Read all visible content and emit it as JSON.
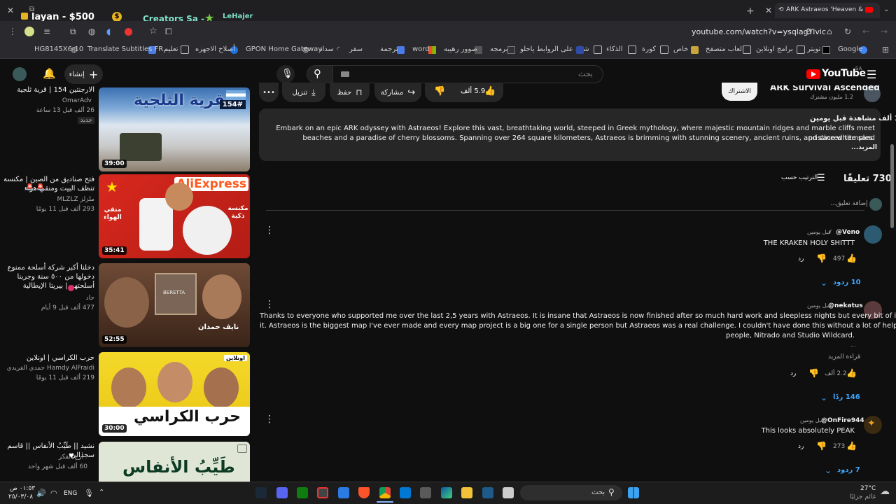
{
  "browser": {
    "tab_left_title": "layan - $500",
    "tab_left_sub": "Creators Sa -",
    "tab_left_user": "LeHajer",
    "active_tab_title": "ARK Astraeos 'Heaven & Aby",
    "url": "youtube.com/watch?v=ysqlagYlvic",
    "bookmarks": [
      "Google",
      "تويتر",
      "برامج اونلاين",
      "العاب متصفح",
      "خاص",
      "كورة",
      "الذكاء",
      "شيك على الروابط ياحلو",
      "برمجه",
      "صوور رهيبه",
      "word",
      "ترجمة",
      "سفر",
      "سداد",
      "GPON Home Gateway",
      "أصلاح الاجهزه",
      "تعليم",
      "Translate Subtitles FR...",
      "HG8145X6-10"
    ]
  },
  "youtube": {
    "logo": "YouTube",
    "region": "SA",
    "search_placeholder": "بحث",
    "create_label": "إنشاء"
  },
  "sidebar": {
    "videos": [
      {
        "title": "الارجنتين 154 | قرية ثلجية",
        "channel": "OmarAdv",
        "meta": "26 ألف  قبل 13 ساعة",
        "badge": "جديد",
        "duration": "39:00",
        "thumb_text": "القرية الثلجية",
        "thumb_num": "154#"
      },
      {
        "title": "فتح صناديق من الصين | مكنسة تنظف البيت ومنقي هواء",
        "channel": "ملزلز MLZLZ",
        "meta": "293 ألف  قبل 11 يومًا",
        "duration": "35:41",
        "thumb_text": "AliExpress",
        "thumb_tag1": "منقي الهواء",
        "thumb_tag2": "مكنسة ذكية"
      },
      {
        "title": "دخلنا أكبر شركة أسلحة ممنوع دخولها من ٥٠٠ سنة وجربنا أسلحتهم | بيريتا الإيطالية",
        "channel": "حاد",
        "meta": "477 ألف  قبل 9 أيام",
        "duration": "52:55",
        "thumb_text": "نايف حمدان",
        "thumb_brand": "BERETTA"
      },
      {
        "title": "حرب الكراسي | اونلاين",
        "channel": "Hamdy AlFraidi حمدي الفريدي",
        "meta": "219 ألف  قبل 11 يومًا",
        "duration": "30:00",
        "thumb_text": "حرب الكراسي",
        "thumb_badge": "اونلاين"
      },
      {
        "title": "نشيد || طَيِّبُ الأنفاس || قاسم سجدالي",
        "channel": "أرج الفكر",
        "meta": "60 ألف  قبل شهر واحد",
        "thumb_text": "طَيِّبُ الأنفاس"
      }
    ]
  },
  "video": {
    "channel_name": "ARK Survival Ascended",
    "subscribers": "1.2 مليون مشترك",
    "subscribe": "الاشتراك",
    "likes": "5.9 ألف",
    "share": "مشاركة",
    "save": "حفظ",
    "download": "تنزيل",
    "views": "199 ألف مشاهدة  قبل يومين",
    "description_line1": "Embark on an epic ARK odyssey with Astraeos! Explore this vast, breathtaking world, steeped in Greek mythology, where majestic mountain ridges and marble cliffs meet pristine white sand",
    "description_line2": "beaches and a paradise of cherry blossoms. Spanning over 264 square kilometers, Astraeos is brimming with stunning scenery, ancient ruins, and sacred temples.",
    "description_more": "...المزيد"
  },
  "comments": {
    "count": "730 تعليقًا",
    "sort": "الترتيب حسب",
    "add_placeholder": "إضافة تعليق...",
    "items": [
      {
        "author": "@Veno",
        "time": "قبل يومين",
        "text": "THE KRAKEN HOLY SHITTT",
        "likes": "497",
        "reply": "رد",
        "replies": "10 ردود"
      },
      {
        "author": "@nekatus",
        "time": "قبل يومين",
        "text_lines": [
          "Thanks to everyone who supported me over the last 2,5 years with Astraeos. It is insane that Astraeos is now finished after so much hard work and sleepless nights but every bit of it was worth",
          "it. Astraeos is the biggest map I've ever made and every map project is a big one for a single person but Astraeos was a real challenge. I couldn't have done this without a lot of help by multiple",
          "people, Nitrado and Studio Wildcard."
        ],
        "ellipsis": "...",
        "read_more": "قراءة المزيد",
        "likes": "2.2 ألف",
        "reply": "رد",
        "replies": "146 ردًا"
      },
      {
        "author": "@OnFire944",
        "time": "قبل يومين",
        "text": "This looks absolutely PEAK",
        "likes": "273",
        "reply": "رد",
        "replies": "7 ردود"
      }
    ]
  },
  "taskbar": {
    "time": "٠١:٥٣ ص",
    "date": "٢٥/٠٣/٠٨",
    "lang": "ENG",
    "search": "بحث",
    "weather_temp": "27°C",
    "weather_desc": "غائم جزئيًا"
  }
}
